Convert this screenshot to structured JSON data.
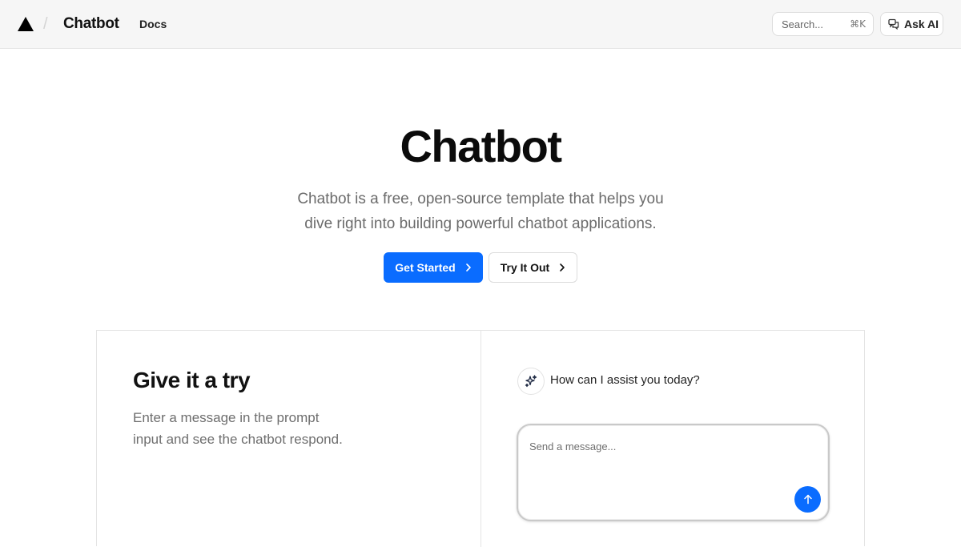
{
  "header": {
    "brand": "Chatbot",
    "nav": {
      "docs_label": "Docs"
    },
    "search": {
      "placeholder": "Search...",
      "shortcut": "⌘K"
    },
    "ask_ai_label": "Ask AI"
  },
  "hero": {
    "title": "Chatbot",
    "subtitle_line1": "Chatbot is a free, open-source template that helps you",
    "subtitle_line2": "dive right into building powerful chatbot applications.",
    "primary_button": "Get Started",
    "secondary_button": "Try It Out"
  },
  "demo": {
    "heading": "Give it a try",
    "description_line1": "Enter a message in the prompt",
    "description_line2": "input and see the chatbot respond.",
    "bot_message": "How can I assist you today?",
    "input_placeholder": "Send a message..."
  },
  "colors": {
    "accent": "#0a6cff",
    "header_bg": "#f6f6f6",
    "muted_text": "#6b6b6b"
  },
  "icons": {
    "logo": "triangle-logo-icon",
    "ask_ai": "chat-bubbles-icon",
    "button_chevron": "chevron-right-icon",
    "bot": "sparkles-icon",
    "send": "arrow-up-icon"
  }
}
